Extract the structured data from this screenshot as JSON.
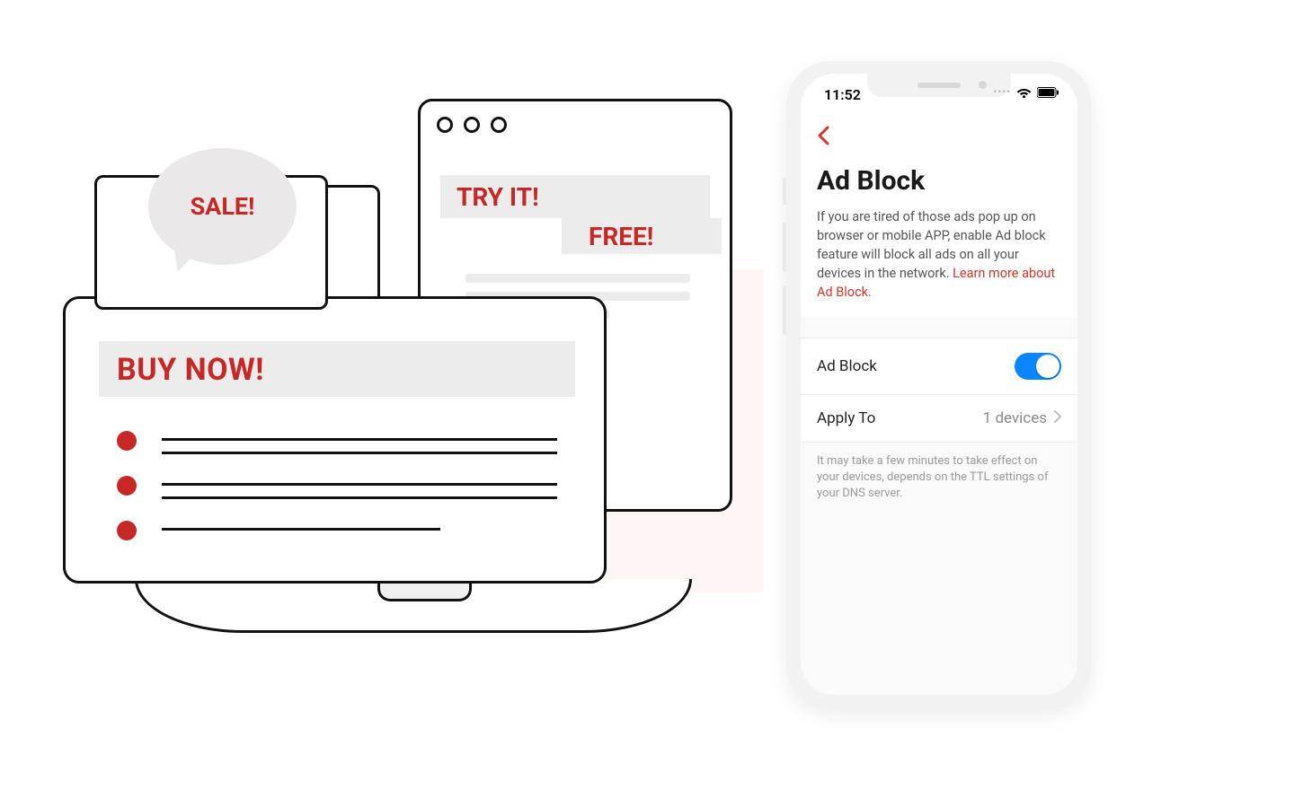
{
  "illustration": {
    "sale_label": "SALE!",
    "buy_now_label": "BUY NOW!",
    "try_it_label": "TRY IT!",
    "free_label": "FREE!"
  },
  "phone": {
    "status": {
      "time": "11:52"
    },
    "page": {
      "title": "Ad Block",
      "description_prefix": "If you are tired of those ads pop up on browser or mobile APP, enable Ad block feature will block all ads on all your devices in the network. ",
      "description_link": "Learn more about Ad Block.",
      "rows": {
        "ad_block": {
          "label": "Ad Block",
          "enabled": true
        },
        "apply_to": {
          "label": "Apply To",
          "value": "1 devices"
        }
      },
      "footer_note": "It may take a few minutes to take effect on your devices, depends on the TTL settings of your DNS server."
    }
  },
  "colors": {
    "accent_red": "#c62828",
    "link_red": "#d1352b",
    "toggle_on": "#0a84ff"
  }
}
